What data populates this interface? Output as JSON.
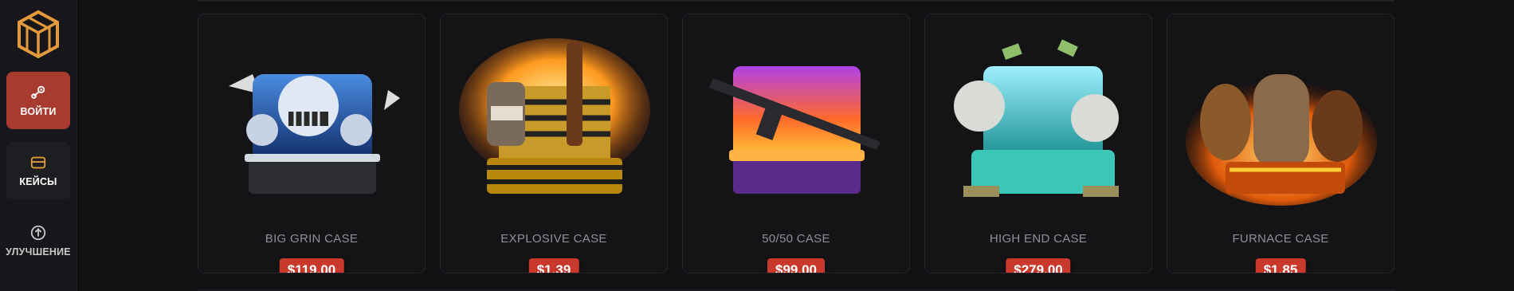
{
  "nav": {
    "login_label": "ВОЙТИ",
    "cases_label": "КЕЙСЫ",
    "upgrade_label": "УЛУЧШЕНИЕ"
  },
  "icons": {
    "logo": "cube-logo-icon",
    "login": "steam-icon",
    "cases": "case-icon",
    "upgrade": "arrow-up-circle-icon"
  },
  "colors": {
    "accent": "#c8392c",
    "login_bg": "#a83a2f",
    "logo": "#e39a3c"
  },
  "cases": [
    {
      "name": "BIG GRIN CASE",
      "price": "$119.00"
    },
    {
      "name": "EXPLOSIVE CASE",
      "price": "$1.39"
    },
    {
      "name": "50/50 CASE",
      "price": "$99.00"
    },
    {
      "name": "HIGH END CASE",
      "price": "$279.00"
    },
    {
      "name": "FURNACE CASE",
      "price": "$1.85"
    }
  ]
}
